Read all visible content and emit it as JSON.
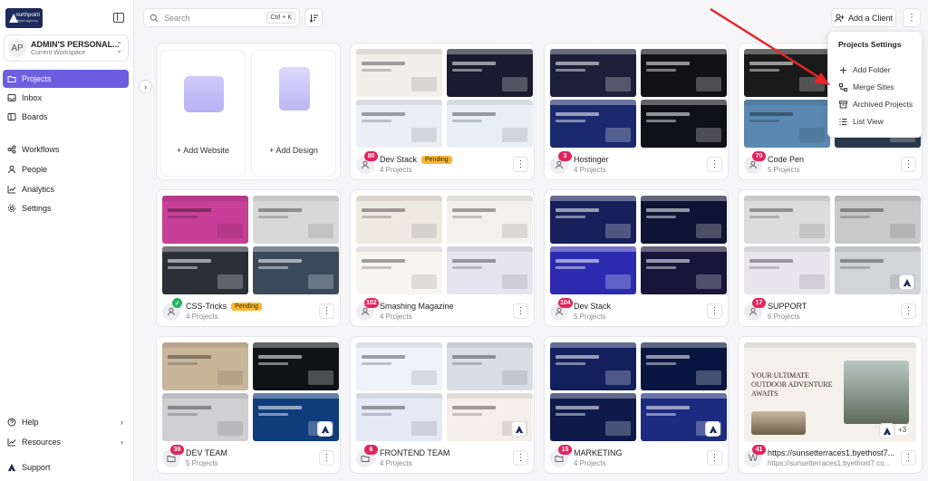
{
  "brand": {
    "name": "northpoint",
    "tagline": "digital agency"
  },
  "workspace": {
    "avatar": "AP",
    "name": "ADMIN'S PERSONAL...",
    "subtitle": "Current Workspace"
  },
  "sidebar": {
    "primary": [
      {
        "label": "Projects",
        "icon": "folder-icon",
        "active": true
      },
      {
        "label": "Inbox",
        "icon": "inbox-icon"
      },
      {
        "label": "Boards",
        "icon": "board-icon"
      }
    ],
    "secondary": [
      {
        "label": "Workflows",
        "icon": "workflow-icon"
      },
      {
        "label": "People",
        "icon": "person-icon"
      },
      {
        "label": "Analytics",
        "icon": "chart-icon"
      },
      {
        "label": "Settings",
        "icon": "gear-icon"
      }
    ],
    "bottom": [
      {
        "label": "Help",
        "icon": "help-icon"
      },
      {
        "label": "Resources",
        "icon": "chart-icon"
      },
      {
        "label": "Support",
        "icon": "logo-icon"
      }
    ]
  },
  "search": {
    "placeholder": "Search",
    "shortcut": "Ctrl + K"
  },
  "toolbar": {
    "add_client": "Add a Client"
  },
  "menu": {
    "title": "Projects Settings",
    "items": [
      {
        "label": "Add Folder",
        "icon": "plus-icon"
      },
      {
        "label": "Merge Sites",
        "icon": "merge-icon"
      },
      {
        "label": "Archived Projects",
        "icon": "archive-icon"
      },
      {
        "label": "List View",
        "icon": "list-icon"
      }
    ]
  },
  "add": {
    "website": "+ Add Website",
    "design": "+ Add Design"
  },
  "colors": {
    "accent": "#6b5fe0",
    "badge": "#e0245e",
    "pending": "#f7b733",
    "arrow": "#e8232a"
  },
  "cards": [
    {
      "name": "Dev Stack",
      "count": "4 Projects",
      "badge": "80",
      "pending": "Pending",
      "thumbs": [
        "#f1efe8",
        "#1b1a2e",
        "#eceef5",
        "#e8eef6"
      ]
    },
    {
      "name": "Hostinger",
      "count": "4 Projects",
      "badge": "3",
      "thumbs": [
        "#1c1f3a",
        "#121215",
        "#1b2a6e",
        "#101018"
      ]
    },
    {
      "name": "Code Pen",
      "count": "5 Projects",
      "badge": "70",
      "thumbs": [
        "#1a1a1a",
        "#2a2a2a",
        "#5a88b0",
        "#2a3a4e"
      ]
    },
    {
      "name": "CSS-Tricks",
      "count": "4 Projects",
      "badge": "",
      "check": true,
      "pending": "Pending",
      "thumbs": [
        "#c83f98",
        "#d8d8d8",
        "#2c2f36",
        "#3a4a5a"
      ]
    },
    {
      "name": "Smashing Magazine",
      "count": "4 Projects",
      "badge": "102",
      "thumbs": [
        "#eeeae2",
        "#f3f1ee",
        "#f7f5f0",
        "#e6e4f0"
      ]
    },
    {
      "name": "Dev Stack",
      "count": "5 Projects",
      "badge": "104",
      "thumbs": [
        "#17205a",
        "#0e1433",
        "#2c2bb0",
        "#19153a"
      ]
    },
    {
      "name": "SUPPORT",
      "count": "6 Projects",
      "badge": "17",
      "thumbs": [
        "#dcdcdc",
        "#c9c9c9",
        "#e8e6ec",
        "#d2d4d8"
      ]
    },
    {
      "name": "DEV TEAM",
      "count": "5 Projects",
      "badge": "39",
      "thumbs": [
        "#c9b59a",
        "#101216",
        "#cfcfd2",
        "#0f3c7a"
      ]
    },
    {
      "name": "FRONTEND TEAM",
      "count": "4 Projects",
      "badge": "6",
      "thumbs": [
        "#eef2fb",
        "#d8dde6",
        "#e3e9f5",
        "#f4efe8"
      ]
    },
    {
      "name": "MARKETING",
      "count": "4 Projects",
      "badge": "15",
      "thumbs": [
        "#12205e",
        "#091642",
        "#0d1a4a",
        "#1c2b80"
      ]
    },
    {
      "name": "https://sunsetterraces1.byethost7...",
      "count": "https://sunsetterraces1.byethost7.co...",
      "badge": "41",
      "single": true,
      "plus": "+3",
      "thumbs": [
        "#f4f1ec"
      ]
    }
  ],
  "hero": {
    "site_text": "YOUR ULTIMATE OUTDOOR ADVENTURE AWAITS"
  }
}
